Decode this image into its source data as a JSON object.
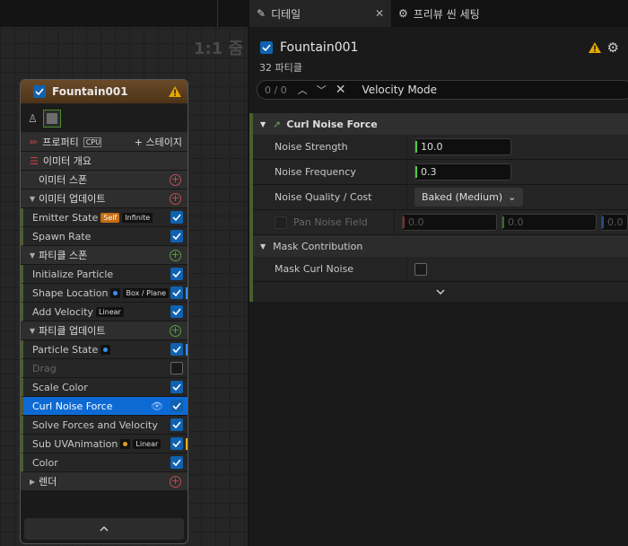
{
  "graph": {
    "zoom_label": "1:1 줌"
  },
  "node": {
    "title": "Fountain001",
    "rows": [
      {
        "kind": "sect-plain",
        "label": "프로퍼티",
        "cpu": "CPU",
        "add_label": "+ 스테이지"
      },
      {
        "kind": "plain",
        "label": "이미터 개요"
      },
      {
        "kind": "sub",
        "label": "이미터 스폰"
      },
      {
        "kind": "sect",
        "label": "이미터 업데이트",
        "add": "r"
      },
      {
        "kind": "mod",
        "label": "Emitter State",
        "tags": [
          "Self",
          "Infinite"
        ]
      },
      {
        "kind": "mod",
        "label": "Spawn Rate"
      },
      {
        "kind": "sect",
        "label": "파티클 스폰",
        "add": "g"
      },
      {
        "kind": "mod",
        "label": "Initialize Particle"
      },
      {
        "kind": "mod",
        "label": "Shape Location",
        "dot": "b",
        "tags2": [
          "Box / Plane"
        ],
        "bar": "b"
      },
      {
        "kind": "mod",
        "label": "Add Velocity",
        "tags2": [
          "Linear"
        ]
      },
      {
        "kind": "sect",
        "label": "파티클 업데이트",
        "add": "g"
      },
      {
        "kind": "mod",
        "label": "Particle State",
        "dot": "b",
        "bar": "b"
      },
      {
        "kind": "mod",
        "label": "Drag",
        "off": true
      },
      {
        "kind": "mod",
        "label": "Scale Color"
      },
      {
        "kind": "mod",
        "label": "Curl Noise Force",
        "sel": true
      },
      {
        "kind": "mod",
        "label": "Solve Forces and Velocity"
      },
      {
        "kind": "mod",
        "label": "Sub UVAnimation",
        "dot": "y",
        "tags2": [
          "Linear"
        ],
        "bar": "y"
      },
      {
        "kind": "mod",
        "label": "Color"
      },
      {
        "kind": "sect",
        "label": "렌더",
        "add": "r",
        "closed": true
      }
    ]
  },
  "tabs": {
    "details": "디테일",
    "preview": "프리뷰 씬 세팅"
  },
  "details": {
    "title": "Fountain001",
    "particles": "32 파티클",
    "search_count": "0 / 0",
    "search_query": "Velocity Mode",
    "section": "Curl Noise Force",
    "props": [
      {
        "label": "Noise Strength",
        "value": "10.0"
      },
      {
        "label": "Noise Frequency",
        "value": "0.3"
      },
      {
        "label": "Noise Quality / Cost",
        "dropdown": "Baked (Medium)"
      }
    ],
    "pan": {
      "label": "Pan Noise Field",
      "x": "0.0",
      "y": "0.0",
      "z": "0.0"
    },
    "mask_section": "Mask Contribution",
    "mask_label": "Mask Curl Noise"
  },
  "colors": {
    "accent": "#0d6ad4",
    "node_header": "#5c3d1f"
  }
}
